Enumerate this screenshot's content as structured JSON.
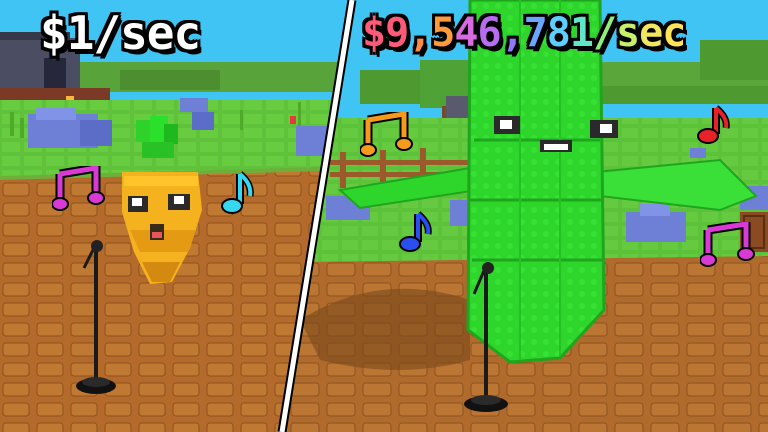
{
  "left_scene": {
    "caption": "$1/sec"
  },
  "right_scene": {
    "caption_chars": [
      {
        "ch": "$",
        "color": "#ff5a7a"
      },
      {
        "ch": "9",
        "color": "#ff5a7a"
      },
      {
        "ch": ",",
        "color": "#ff8a4a"
      },
      {
        "ch": "5",
        "color": "#ff9a3c"
      },
      {
        "ch": "4",
        "color": "#d86be0"
      },
      {
        "ch": "6",
        "color": "#b86df0"
      },
      {
        "ch": ",",
        "color": "#8f7af5"
      },
      {
        "ch": "7",
        "color": "#6aa6ff"
      },
      {
        "ch": "8",
        "color": "#5ccfff"
      },
      {
        "ch": "1",
        "color": "#62e6c8"
      },
      {
        "ch": "/",
        "color": "#8ef07a"
      },
      {
        "ch": "s",
        "color": "#c7f06a"
      },
      {
        "ch": "e",
        "color": "#f0e660"
      },
      {
        "ch": "c",
        "color": "#ffe458"
      }
    ]
  },
  "colors": {
    "sky": "#3fc4f4",
    "grass": "#62c93a",
    "dirt": "#b46a2a",
    "carrot": "#f5b21f",
    "leaf": "#2fd22a",
    "bamboo": "#2ed62c",
    "note_magenta": "#d93ad6",
    "note_cyan": "#36d7f0",
    "note_orange": "#f59a1c",
    "note_blue": "#2a4ff0",
    "note_red": "#e8222a",
    "divider": "#ffffff"
  },
  "icons": [
    "music-note-icon",
    "microphone-stand-icon"
  ]
}
